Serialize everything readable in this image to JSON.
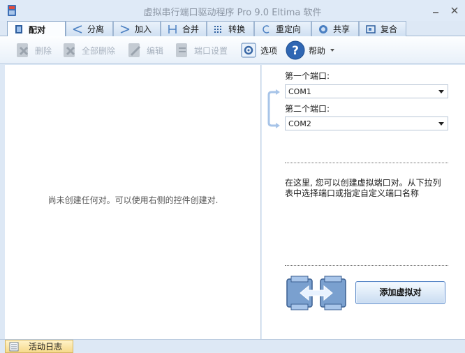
{
  "window": {
    "title": "虚拟串行端口驱动程序 Pro 9.0 Eltima 软件"
  },
  "tabs": [
    {
      "label": "配对",
      "icon": "pair-port-icon",
      "active": true
    },
    {
      "label": "分离",
      "icon": "split-icon"
    },
    {
      "label": "加入",
      "icon": "join-icon"
    },
    {
      "label": "合并",
      "icon": "merge-icon"
    },
    {
      "label": "转换",
      "icon": "convert-icon"
    },
    {
      "label": "重定向",
      "icon": "redirect-icon"
    },
    {
      "label": "共享",
      "icon": "share-icon"
    },
    {
      "label": "复合",
      "icon": "composite-icon"
    }
  ],
  "toolbar": {
    "delete_label": "删除",
    "delete_all_label": "全部删除",
    "edit_label": "编辑",
    "port_settings_label": "端口设置",
    "options_label": "选项",
    "help_label": "帮助"
  },
  "left": {
    "empty_message": "尚未创建任何对。可以使用右侧的控件创建对."
  },
  "right": {
    "first_port_label": "第一个端口:",
    "first_port_value": "COM1",
    "second_port_label": "第二个端口:",
    "second_port_value": "COM2",
    "description_line1": "在这里, 您可以创建虚拟端口对。从下拉列",
    "description_line2": "表中选择端口或指定自定义端口名称",
    "add_button_label": "添加虚拟对"
  },
  "statusbar": {
    "activity_log_label": "活动日志"
  },
  "colors": {
    "accent": "#3a76c4",
    "toolbar_bg": "#e8f0f9",
    "log_tab": "#f6d98b"
  }
}
